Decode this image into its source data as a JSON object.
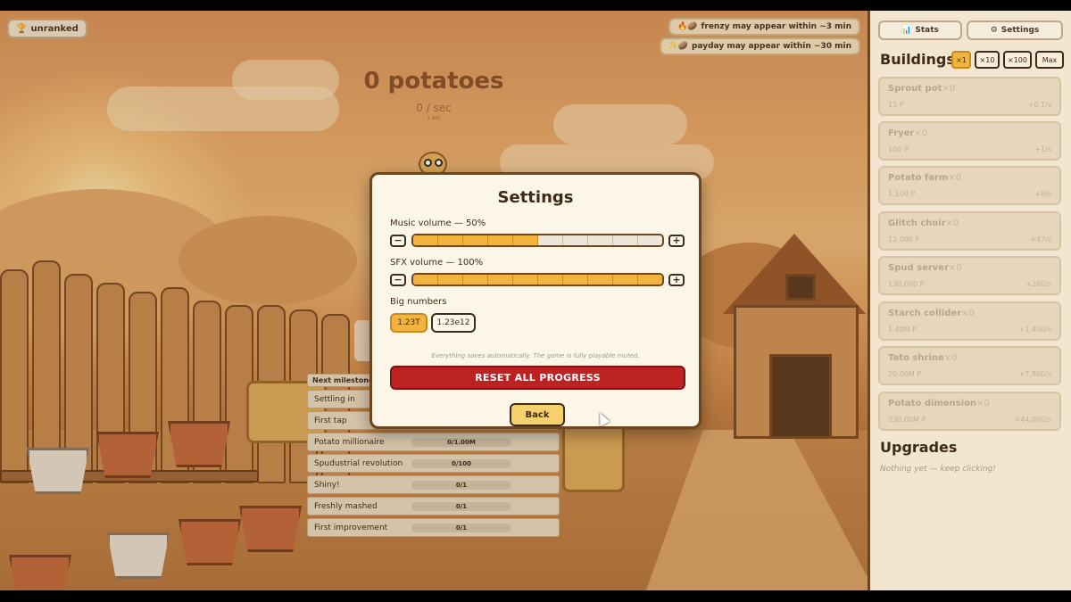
{
  "hud": {
    "rank_icon": "trophy-icon",
    "rank_label": "unranked",
    "notices": [
      {
        "icon": "fire-potato-icon",
        "label": "frenzy may appear within ~3 min"
      },
      {
        "icon": "coin-potato-icon",
        "label": "payday may appear within ~30 min"
      }
    ],
    "potato_count": "0 potatoes",
    "rate": "0 / sec",
    "rate_sub": "1 sec"
  },
  "milestones": {
    "header": "Next milestones",
    "items": [
      {
        "name": "Settling in",
        "progress": ""
      },
      {
        "name": "First tap",
        "progress": ""
      },
      {
        "name": "Potato millionaire",
        "progress": "0/1.00M"
      },
      {
        "name": "Spudustrial revolution",
        "progress": "0/100"
      },
      {
        "name": "Shiny!",
        "progress": "0/1"
      },
      {
        "name": "Freshly mashed",
        "progress": "0/1"
      },
      {
        "name": "First improvement",
        "progress": "0/1"
      }
    ]
  },
  "settings": {
    "title": "Settings",
    "music_label": "Music volume — 50%",
    "music_level": 0.5,
    "sfx_label": "SFX volume — 100%",
    "sfx_level": 1.0,
    "minus": "−",
    "plus": "+",
    "big_numbers_label": "Big numbers",
    "format_options": [
      "1.23T",
      "1.23e12"
    ],
    "format_selected": "1.23T",
    "hint": "Everything saves automatically. The game is fully playable muted.",
    "reset_label": "RESET ALL PROGRESS",
    "back_label": "Back"
  },
  "panel": {
    "tabs": [
      {
        "icon": "chart-icon",
        "label": "Stats"
      },
      {
        "icon": "gear-icon",
        "label": "Settings"
      }
    ],
    "buildings_title": "Buildings",
    "multipliers": [
      "×1",
      "×10",
      "×100",
      "Max"
    ],
    "multiplier_selected": "×1",
    "buildings": [
      {
        "name": "Sprout pot",
        "owned": "×0",
        "cost": "15 P",
        "rate": "+0.1/s"
      },
      {
        "name": "Fryer",
        "owned": "×0",
        "cost": "100 P",
        "rate": "+1/s"
      },
      {
        "name": "Potato farm",
        "owned": "×0",
        "cost": "1,100 P",
        "rate": "+8/s"
      },
      {
        "name": "Glitch choir",
        "owned": "×0",
        "cost": "12,000 P",
        "rate": "+47/s"
      },
      {
        "name": "Spud server",
        "owned": "×0",
        "cost": "130,000 P",
        "rate": "+260/s"
      },
      {
        "name": "Starch collider",
        "owned": "×0",
        "cost": "1.40M P",
        "rate": "+1,400/s"
      },
      {
        "name": "Tato shrine",
        "owned": "×0",
        "cost": "20.00M P",
        "rate": "+7,800/s"
      },
      {
        "name": "Potato dimension",
        "owned": "×0",
        "cost": "330.00M P",
        "rate": "+44,000/s"
      }
    ],
    "upgrades_title": "Upgrades",
    "upgrades_empty": "Nothing yet — keep clicking!"
  },
  "colors": {
    "accent": "#f2b43e",
    "danger": "#bd2222",
    "frame": "#6e4521"
  }
}
